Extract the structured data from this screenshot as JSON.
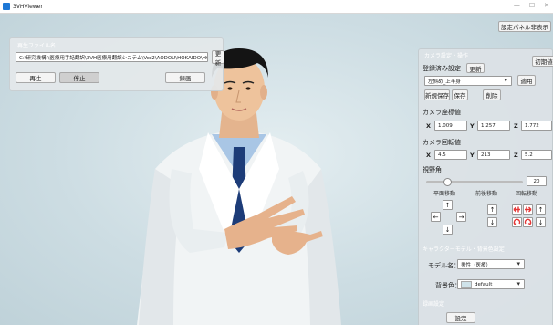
{
  "window": {
    "title": "3VHViewer",
    "minimize": "—",
    "maximize": "☐",
    "close": "✕"
  },
  "toolbar": {
    "toggle_panel_label": "設定パネル非表示"
  },
  "file_panel": {
    "caption": "再生ファイル名",
    "path_value": "C:\\研究機構-\\医療用手話翻訳\\3VH医療用翻訳システム\\Ver2\\AODOU\\HOKAIDO\\HOKAIDO\\Anim",
    "update_label": "更新",
    "play_label": "再生",
    "stop_label": "停止",
    "record_label": "録画"
  },
  "camera_panel": {
    "caption": "カメラ設定・操作",
    "init_label": "初期値",
    "registered_title": "登録済み設定",
    "refresh_label": "更新",
    "preset_value": "左斜め_上半身",
    "apply_label": "適用",
    "new_save_label": "新規保存",
    "save_label": "保存",
    "delete_label": "削除",
    "position_title": "カメラ座標値",
    "position": {
      "x_label": "X",
      "x": "1.009",
      "y_label": "Y",
      "y": "1.257",
      "z_label": "Z",
      "z": "1.772"
    },
    "rotation_title": "カメラ回転値",
    "rotation": {
      "x_label": "X",
      "x": "4.5",
      "y_label": "Y",
      "y": "213",
      "z_label": "Z",
      "z": "5.2"
    },
    "fov_title": "視野角",
    "fov_value": "20",
    "fov_fraction": 0.22,
    "move_plane_label": "平面移動",
    "move_depth_label": "前後移動",
    "move_rotate_label": "回転移動",
    "arrows": {
      "up": "↑",
      "down": "↓",
      "left": "←",
      "right": "→"
    }
  },
  "model_panel": {
    "caption": "キャラクターモデル・背景色設定",
    "model_label": "モデル名：",
    "model_value": "男性（医療）",
    "bg_label": "背景色：",
    "bg_value": "default",
    "bg_swatch": "#cfe3ea"
  },
  "record_panel": {
    "caption": "録画設定",
    "settings_label": "設定"
  },
  "colors": {
    "accent_red": "#e53535",
    "panel_caption": "#ffffff"
  }
}
